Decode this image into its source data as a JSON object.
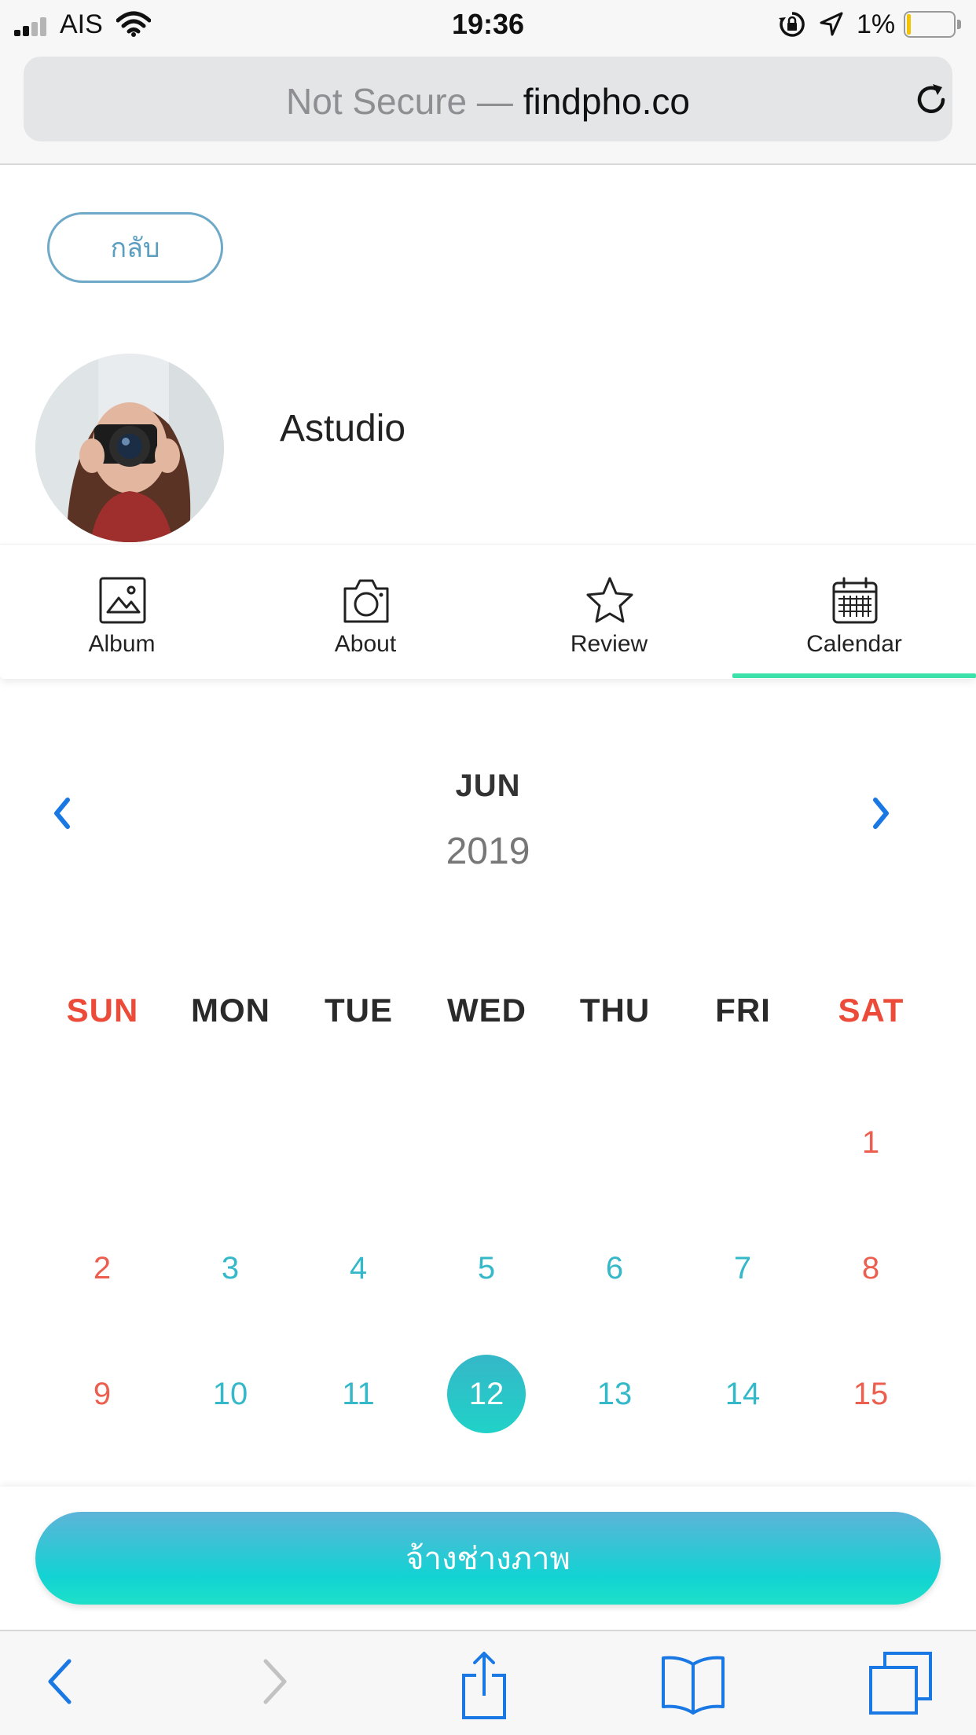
{
  "status_bar": {
    "carrier": "AIS",
    "time": "19:36",
    "battery_percent": "1%",
    "battery_level": 0.01,
    "signal_bars": 4,
    "signal_bars_filled": 2,
    "icons": [
      "signal-icon",
      "wifi-icon",
      "rotation-lock-icon",
      "location-icon",
      "battery-icon"
    ]
  },
  "browser": {
    "security_label": "Not Secure —",
    "domain": "findpho.co",
    "reload_icon": "reload-icon"
  },
  "page": {
    "back_label": "กลับ",
    "profile_name": "Astudio",
    "tabs": [
      {
        "label": "Album",
        "icon": "image-icon",
        "active": false
      },
      {
        "label": "About",
        "icon": "camera-icon",
        "active": false
      },
      {
        "label": "Review",
        "icon": "star-icon",
        "active": false
      },
      {
        "label": "Calendar",
        "icon": "calendar-icon",
        "active": true
      }
    ],
    "accent_color": "#3de2ab"
  },
  "calendar": {
    "month": "JUN",
    "year": "2019",
    "weekdays": [
      "SUN",
      "MON",
      "TUE",
      "WED",
      "THU",
      "FRI",
      "SAT"
    ],
    "first_day_column": 6,
    "days": [
      "1",
      "2",
      "3",
      "4",
      "5",
      "6",
      "7",
      "8",
      "9",
      "10",
      "11",
      "12",
      "13",
      "14",
      "15"
    ],
    "selected_day": "12",
    "weekend_color": "#ec4b3a",
    "weekday_day_color": "#35b9c9"
  },
  "action": {
    "hire_label": "จ้างช่างภาพ"
  },
  "toolbar": {
    "items": [
      "back-icon",
      "forward-icon",
      "share-icon",
      "bookmarks-icon",
      "tabs-icon"
    ]
  }
}
